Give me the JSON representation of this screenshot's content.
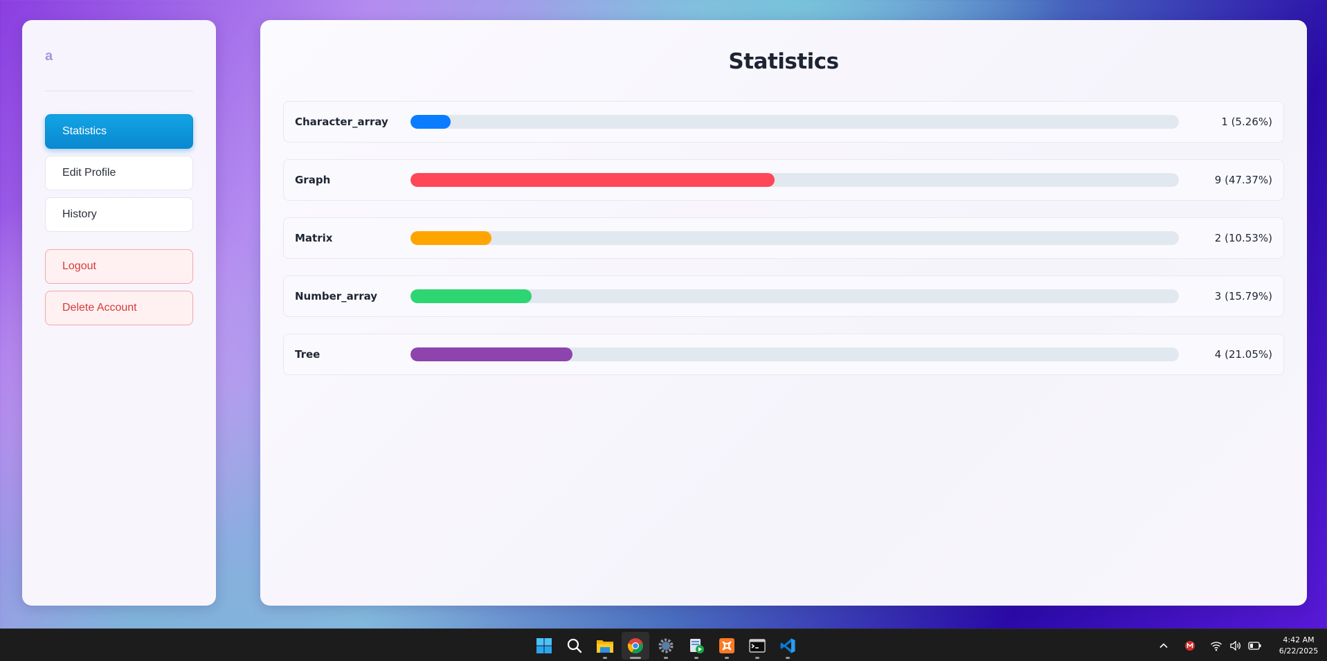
{
  "sidebar": {
    "brand": "a",
    "nav": [
      {
        "label": "Statistics",
        "active": true
      },
      {
        "label": "Edit Profile",
        "active": false
      },
      {
        "label": "History",
        "active": false
      }
    ],
    "danger": [
      {
        "label": "Logout"
      },
      {
        "label": "Delete Account"
      }
    ]
  },
  "main": {
    "title": "Statistics",
    "stats": [
      {
        "label": "Character_array",
        "count": 1,
        "percent": 5.26,
        "value_text": "1 (5.26%)",
        "color": "#0a7cff"
      },
      {
        "label": "Graph",
        "count": 9,
        "percent": 47.37,
        "value_text": "9 (47.37%)",
        "color": "#ff4757"
      },
      {
        "label": "Matrix",
        "count": 2,
        "percent": 10.53,
        "value_text": "2 (10.53%)",
        "color": "#ffa502"
      },
      {
        "label": "Number_array",
        "count": 3,
        "percent": 15.79,
        "value_text": "3 (15.79%)",
        "color": "#2ed573"
      },
      {
        "label": "Tree",
        "count": 4,
        "percent": 21.05,
        "value_text": "4 (21.05%)",
        "color": "#8e44ad"
      }
    ]
  },
  "taskbar": {
    "apps": [
      {
        "icon": "windows-start-icon",
        "running": false
      },
      {
        "icon": "search-icon",
        "running": false
      },
      {
        "icon": "file-explorer-icon",
        "running": true
      },
      {
        "icon": "chrome-icon",
        "running": true,
        "active": true
      },
      {
        "icon": "settings-gear-icon",
        "running": true
      },
      {
        "icon": "task-manager-icon",
        "running": true
      },
      {
        "icon": "xampp-icon",
        "running": true
      },
      {
        "icon": "terminal-icon",
        "running": true
      },
      {
        "icon": "vscode-icon",
        "running": true
      }
    ],
    "tray": {
      "time": "4:42 AM",
      "date": "6/22/2025"
    }
  }
}
